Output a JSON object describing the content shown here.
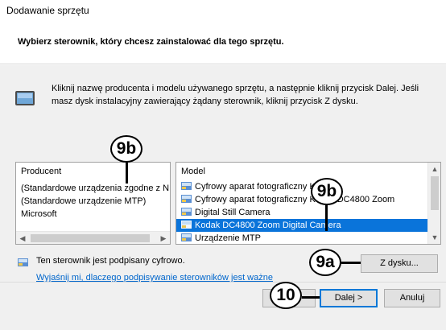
{
  "window": {
    "title": "Dodawanie sprzętu",
    "heading": "Wybierz sterownik, który chcesz zainstalować dla tego sprzętu."
  },
  "instructions": {
    "text": "Kliknij nazwę producenta i modelu używanego sprzętu, a następnie kliknij przycisk Dalej. Jeśli masz dysk instalacyjny zawierający żądany sterownik, kliknij przycisk Z dysku.",
    "icon": "device-icon"
  },
  "manufacturer_list": {
    "header": "Producent",
    "items": [
      "(Standardowe urządzenia zgodne z N",
      "(Standardowe urządzenie MTP)",
      "Microsoft"
    ]
  },
  "model_list": {
    "header": "Model",
    "items": [
      "Cyfrowy aparat fotograficzny K",
      "Cyfrowy aparat fotograficzny Kodak DC4800 Zoom",
      "Digital Still Camera",
      "Kodak DC4800 Zoom Digital Camera",
      "Urządzenie MTP"
    ],
    "selected_index": 3,
    "item_icon": "device-driver-icon"
  },
  "signature": {
    "text": "Ten sterownik jest podpisany cyfrowo.",
    "link": "Wyjaśnij mi, dlaczego podpisywanie sterowników jest ważne",
    "icon": "driver-signed-icon"
  },
  "buttons": {
    "have_disk": "Z dysku...",
    "next": "Dalej >",
    "cancel": "Anuluj"
  },
  "callouts": [
    "9b",
    "9b",
    "9a",
    "10"
  ],
  "colors": {
    "selection": "#0a74da",
    "link": "#0066cc",
    "panel_bg": "#f0f0f0"
  }
}
